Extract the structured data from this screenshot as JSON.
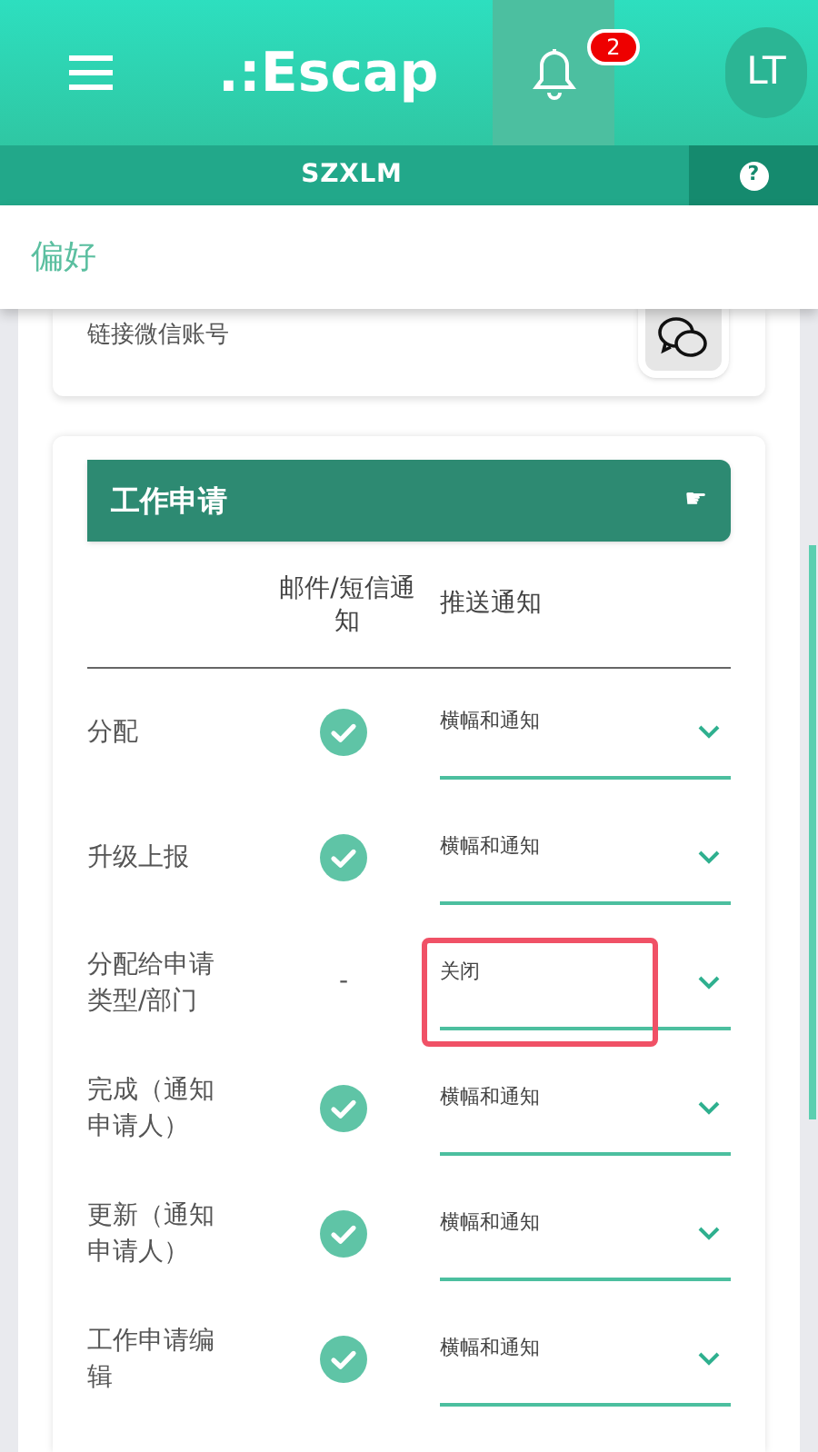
{
  "header": {
    "logo": ".:Escap",
    "notifications": "2",
    "avatar": "LT"
  },
  "subbar": {
    "title": "SZXLM",
    "help": "?"
  },
  "page_title": "偏好",
  "wechat": {
    "label": "链接微信账号"
  },
  "section": {
    "title": "工作申请",
    "icon": "☛",
    "columns": [
      "邮件/短信通知",
      "推送通知"
    ],
    "rows": [
      {
        "label": "分配",
        "email": {
          "kind": "check"
        },
        "push": "横幅和通知",
        "highlighted": false
      },
      {
        "label": "升级上报",
        "email": {
          "kind": "check"
        },
        "push": "横幅和通知",
        "highlighted": false
      },
      {
        "label": "分配给申请类型/部门",
        "email": {
          "kind": "text",
          "text": "-"
        },
        "push": "关闭",
        "highlighted": true
      },
      {
        "label": "完成（通知申请人）",
        "email": {
          "kind": "check"
        },
        "push": "横幅和通知",
        "highlighted": false
      },
      {
        "label": "更新（通知申请人）",
        "email": {
          "kind": "check"
        },
        "push": "横幅和通知",
        "highlighted": false
      },
      {
        "label": "工作申请编辑",
        "email": {
          "kind": "check"
        },
        "push": "横幅和通知",
        "highlighted": false
      }
    ]
  }
}
